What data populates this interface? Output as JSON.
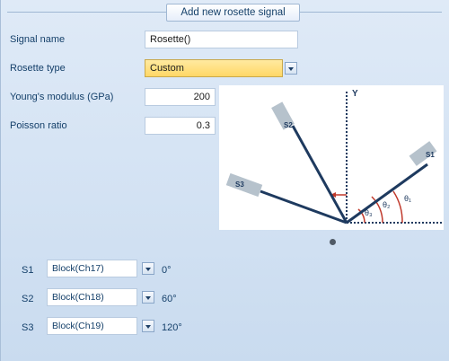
{
  "dialog": {
    "title": "Add new rosette signal"
  },
  "form": {
    "signal_name_label": "Signal name",
    "signal_name_value": "Rosette()",
    "rosette_type_label": "Rosette type",
    "rosette_type_value": "Custom",
    "youngs_label": "Young's modulus (GPa)",
    "youngs_value": "200",
    "poisson_label": "Poisson ratio",
    "poisson_value": "0.3"
  },
  "diagram": {
    "axis_label": "Y",
    "gauges": [
      "S1",
      "S2",
      "S3"
    ],
    "angle_labels": [
      "θ₃",
      "θ₂",
      "θ₁"
    ]
  },
  "gauges": [
    {
      "label": "S1",
      "block": "Block(Ch17)",
      "angle": "0°"
    },
    {
      "label": "S2",
      "block": "Block(Ch18)",
      "angle": "60°"
    },
    {
      "label": "S3",
      "block": "Block(Ch19)",
      "angle": "120°"
    }
  ],
  "colors": {
    "highlight": "#ffd766",
    "diagram_line": "#1e3a5f",
    "angle_arc": "#c0392b",
    "strip": "#b6c2cc"
  }
}
